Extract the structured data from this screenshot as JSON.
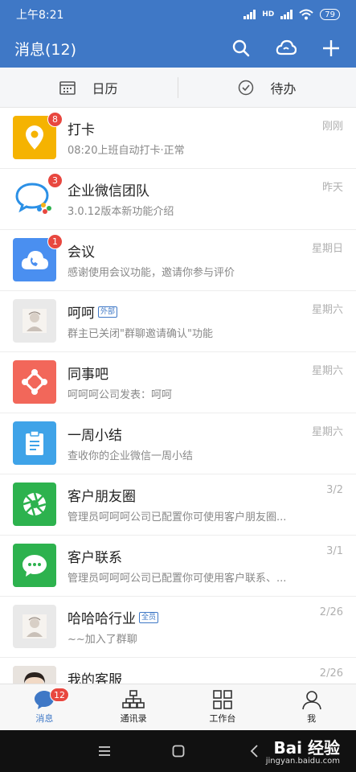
{
  "status_bar": {
    "time": "上午8:21",
    "battery": "79"
  },
  "title_bar": {
    "title": "消息(12)"
  },
  "subnav": {
    "calendar_label": "日历",
    "todo_label": "待办"
  },
  "colors": {
    "brand": "#3f78c6",
    "badge": "#e8473f"
  },
  "messages": [
    {
      "name": "打卡",
      "preview": "08:20上班自动打卡·正常",
      "time": "刚刚",
      "badge": "8",
      "icon": "location-pin-icon",
      "color": "#f5b301"
    },
    {
      "name": "企业微信团队",
      "preview": "3.0.12版本新功能介绍",
      "time": "昨天",
      "badge": "3",
      "icon": "wecom-logo-icon",
      "color": "#ffffff"
    },
    {
      "name": "会议",
      "preview": "感谢使用会议功能，邀请你参与评价",
      "time": "星期日",
      "badge": "1",
      "icon": "cloud-phone-icon",
      "color": "#4a8ff0"
    },
    {
      "name": "呵呵",
      "tag": "外部",
      "preview": "群主已关闭\"群聊邀请确认\"功能",
      "time": "星期六",
      "icon": "group-avatar-icon",
      "color": "#e9e9e9"
    },
    {
      "name": "同事吧",
      "preview": "呵呵呵公司发表：呵呵",
      "time": "星期六",
      "icon": "network-icon",
      "color": "#f2675a"
    },
    {
      "name": "一周小结",
      "preview": "查收你的企业微信一周小结",
      "time": "星期六",
      "icon": "clipboard-icon",
      "color": "#3fa3e8"
    },
    {
      "name": "客户朋友圈",
      "preview": "管理员呵呵呵公司已配置你可使用客户朋友圈...",
      "time": "3/2",
      "icon": "aperture-icon",
      "color": "#2db24e"
    },
    {
      "name": "客户联系",
      "preview": "管理员呵呵呵公司已配置你可使用客户联系、...",
      "time": "3/1",
      "icon": "chat-bubble-icon",
      "color": "#2db24e"
    },
    {
      "name": "哈哈哈行业",
      "tag": "全员",
      "preview": "~~加入了群聊",
      "time": "2/26",
      "icon": "group-avatar-icon",
      "color": "#e9e9e9"
    },
    {
      "name": "我的客服",
      "preview": "",
      "time": "2/26",
      "icon": "person-photo-icon",
      "color": "#d9d2cc"
    }
  ],
  "tabbar": {
    "messages": "消息",
    "messages_badge": "12",
    "contacts": "通讯录",
    "workbench": "工作台",
    "me": "我"
  },
  "watermark": {
    "main": "Bai 经验",
    "sub": "jingyan.baidu.com"
  }
}
